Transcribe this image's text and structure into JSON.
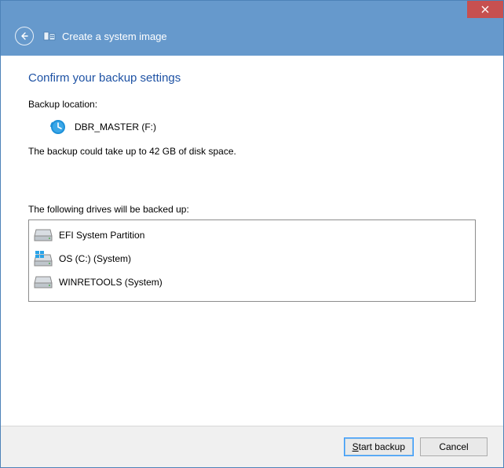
{
  "window": {
    "title": "Create a system image"
  },
  "page": {
    "heading": "Confirm your backup settings",
    "backup_location_label": "Backup location:",
    "backup_location_value": "DBR_MASTER (F:)",
    "size_note": "The backup could take up to 42 GB of disk space.",
    "drives_label": "The following drives will be backed up:",
    "drives": [
      {
        "name": "EFI System Partition"
      },
      {
        "name": "OS (C:) (System)"
      },
      {
        "name": "WINRETOOLS (System)"
      }
    ]
  },
  "buttons": {
    "start": "Start backup",
    "cancel": "Cancel"
  }
}
